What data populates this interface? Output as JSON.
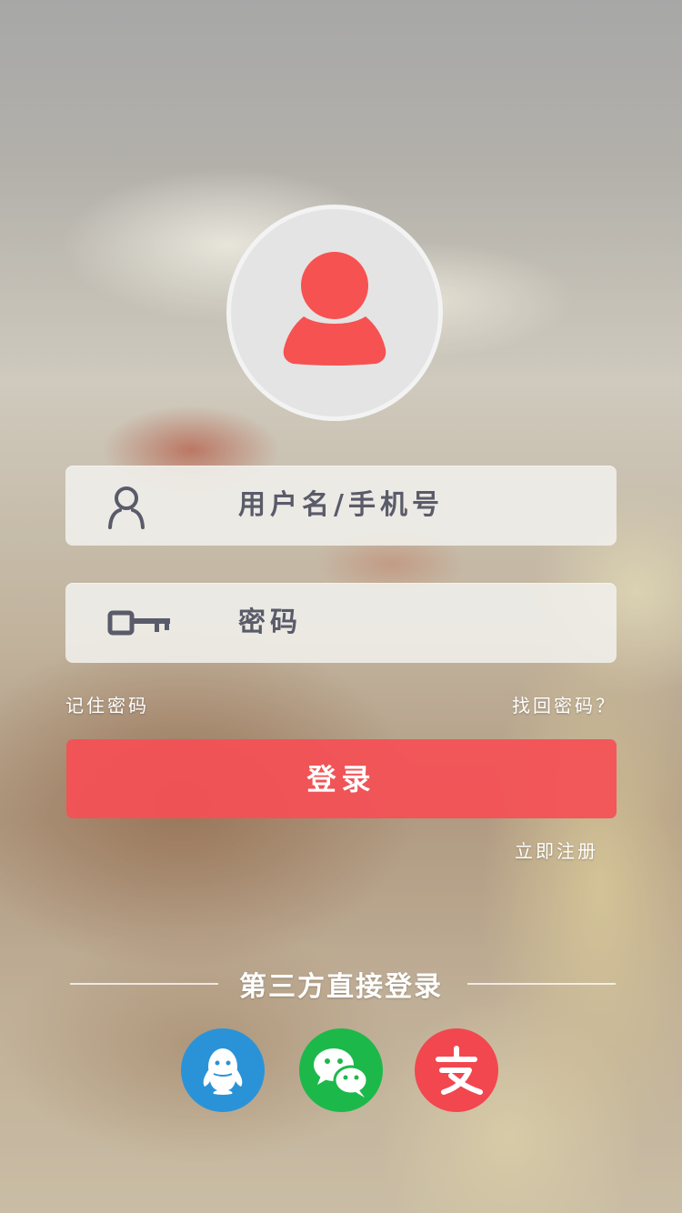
{
  "colors": {
    "accent": "#f5505a",
    "icon_gray": "#5a5b6a",
    "qq": "#2a93d8",
    "wechat": "#1cb94a",
    "alipay": "#f2474f"
  },
  "login_form": {
    "username_placeholder": "用户名/手机号",
    "password_placeholder": "密码",
    "remember_label": "记住密码",
    "forgot_label": "找回密码？",
    "login_button": "登录",
    "register_link": "立即注册"
  },
  "third_party": {
    "title": "第三方直接登录",
    "providers": [
      {
        "name": "QQ",
        "icon": "qq-icon"
      },
      {
        "name": "WeChat",
        "icon": "wechat-icon"
      },
      {
        "name": "Alipay",
        "icon": "alipay-icon"
      }
    ]
  }
}
